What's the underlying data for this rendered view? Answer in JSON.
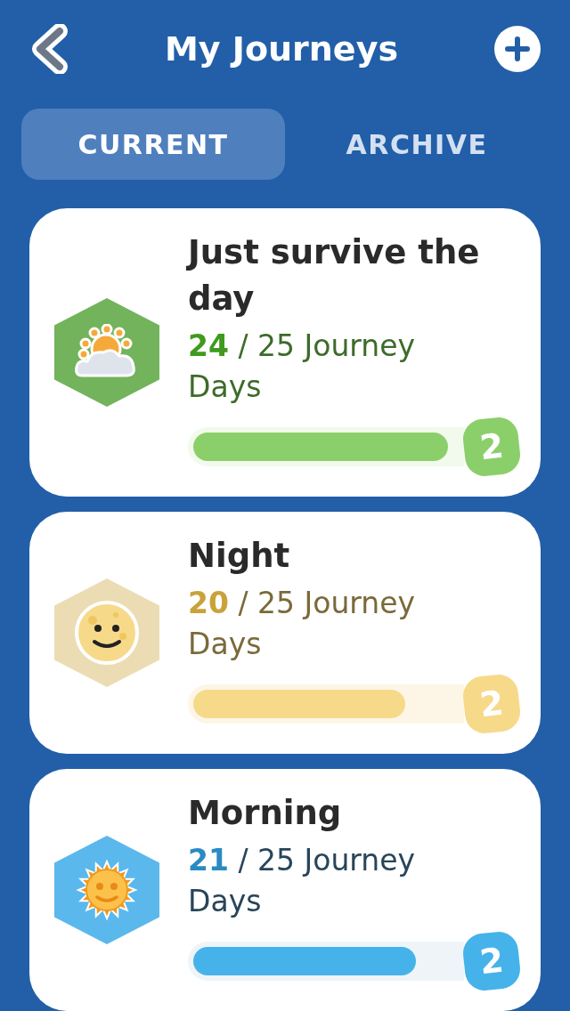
{
  "header": {
    "title": "My Journeys"
  },
  "tabs": [
    {
      "label": "CURRENT",
      "selected": true
    },
    {
      "label": "ARCHIVE",
      "selected": false
    }
  ],
  "journeys": [
    {
      "title": "Just survive the day",
      "kind": "cloud-sun",
      "color": "#8bcf6b",
      "done": "24",
      "total_text": "/ 25 Journey Days",
      "level": 0.96,
      "badge": "2"
    },
    {
      "title": "Night",
      "kind": "moon",
      "color": "#f7d98a",
      "done": "20",
      "total_text": "/ 25 Journey Days",
      "level": 0.8,
      "badge": "2"
    },
    {
      "title": "Morning",
      "kind": "sun",
      "color": "#45b3ea",
      "done": "21",
      "total_text": "/ 25 Journey Days",
      "level": 0.84,
      "badge": "2"
    }
  ]
}
